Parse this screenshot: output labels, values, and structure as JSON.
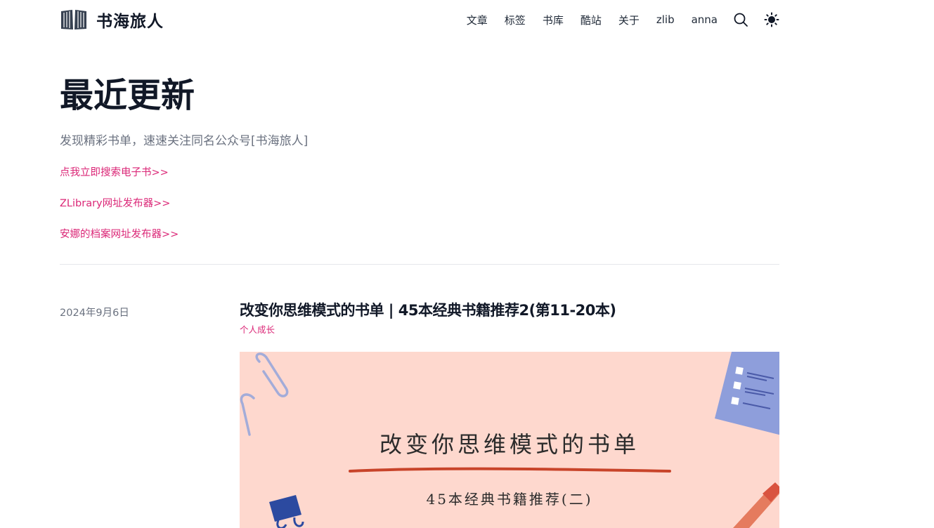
{
  "site": {
    "title": "书海旅人",
    "nav": [
      "文章",
      "标签",
      "书库",
      "酷站",
      "关于",
      "zlib",
      "anna"
    ]
  },
  "hero": {
    "title": "最近更新",
    "subtitle": "发现精彩书单，速速关注同名公众号[书海旅人]",
    "links": [
      "点我立即搜索电子书>>",
      "ZLibrary网址发布器>>",
      "安娜的档案网址发布器>>"
    ]
  },
  "post": {
    "date": "2024年9月6日",
    "title": "改变你思维模式的书单 | 45本经典书籍推荐2(第11-20本)",
    "tag": "个人成长",
    "cover_title": "改变你思维模式的书单",
    "cover_subtitle": "45本经典书籍推荐(二)"
  },
  "colors": {
    "accent": "#db2777",
    "cover_bg": "#fed8ce",
    "cover_underline": "#c8442a",
    "note_blue": "#8e9edb"
  },
  "icons": [
    "book-logo-icon",
    "search-icon",
    "sun-icon"
  ]
}
